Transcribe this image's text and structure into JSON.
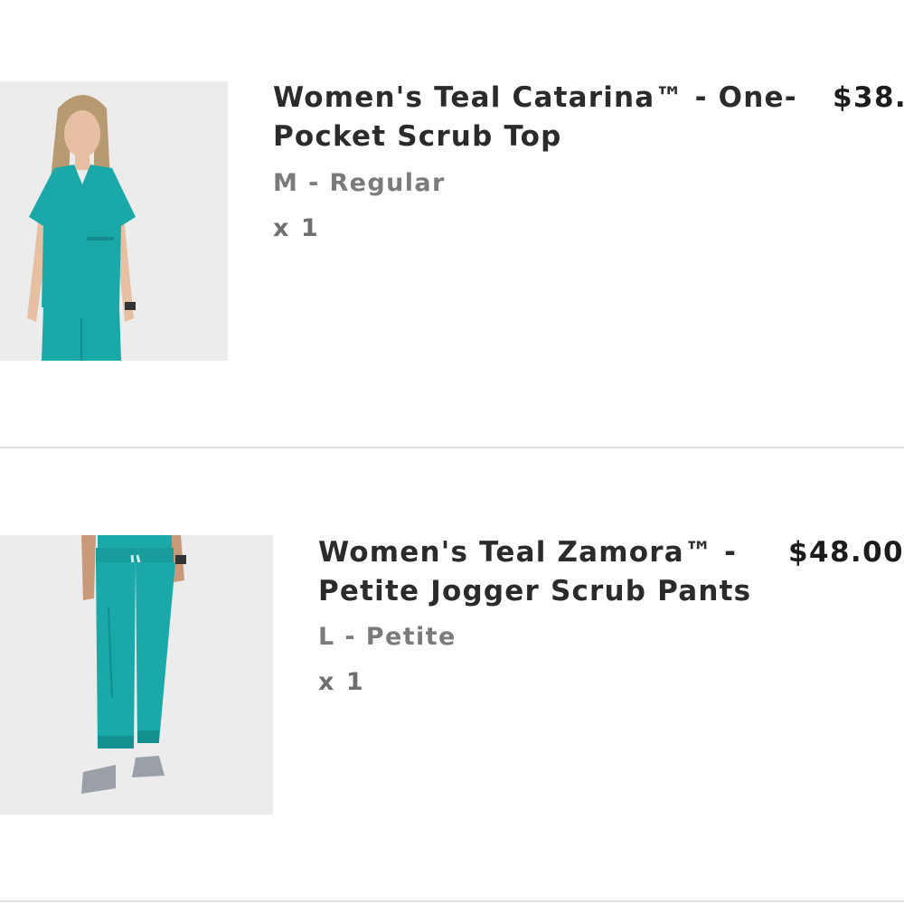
{
  "cart": {
    "items": [
      {
        "title": "Women's Teal Catarina™ - One-Pocket Scrub Top",
        "variant": "M - Regular",
        "quantity": "x 1",
        "price": "$38.",
        "image_icon": "product-image-scrub-top",
        "colors": {
          "product": "#1aa8a8",
          "skin": "#e7c0a3",
          "hair": "#b89a72"
        }
      },
      {
        "title": "Women's Teal Zamora™ - Petite Jogger Scrub Pants",
        "variant": "L - Petite",
        "quantity": "x 1",
        "price": "$48.00",
        "image_icon": "product-image-jogger-pants",
        "colors": {
          "product": "#1aa8a8",
          "shoe": "#9aa0a6",
          "skin": "#c99a7a"
        }
      }
    ]
  },
  "theme": {
    "title_color": "#2b2b2b",
    "variant_color": "#7b7b7b",
    "price_color": "#1c1c1c",
    "divider_color": "#dedede",
    "image_bg": "#ececec"
  }
}
